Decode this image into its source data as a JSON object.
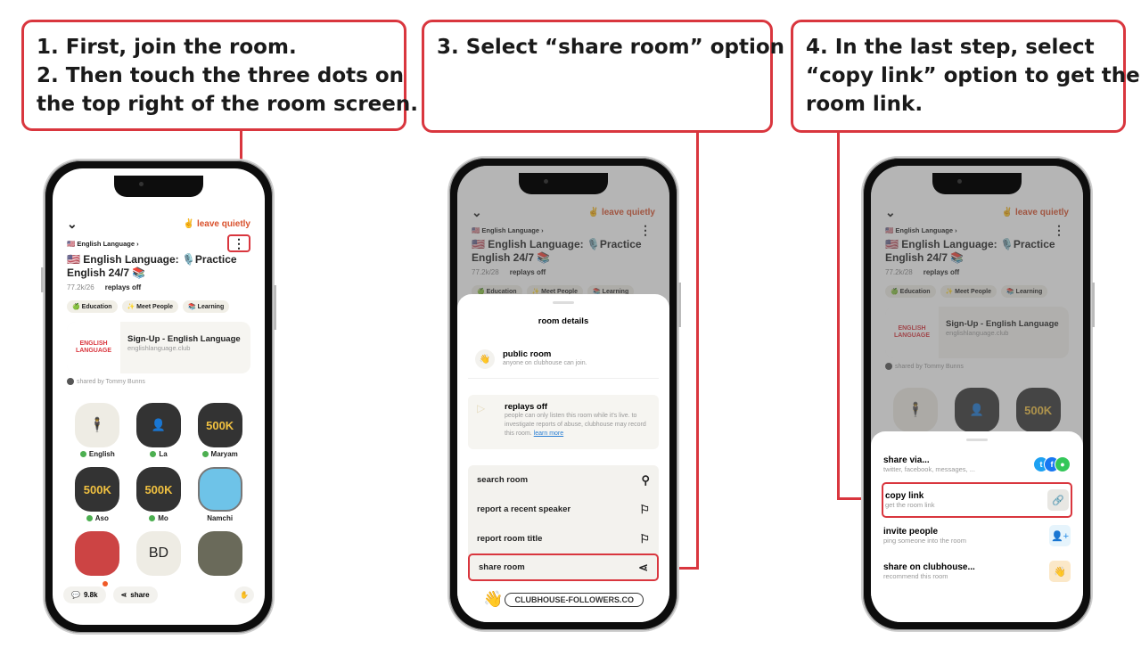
{
  "callouts": {
    "step1": [
      "1. First, join the room.",
      "2. Then touch the three dots on",
      "the top right of the room screen."
    ],
    "step3": [
      "3. Select “share room” option"
    ],
    "step4": [
      "4. In the last step, select",
      "“copy link” option to get the",
      "room link."
    ]
  },
  "room": {
    "leave_label": "✌ leave quietly",
    "club_label": "🇺🇸 English Language ›",
    "title": "🇺🇸 English Language: 🎙️Practice English 24/7 📚",
    "listeners": "77.2k/28",
    "listeners_phone1": "77.2k/26",
    "replays": "replays off",
    "tags": [
      "🍏 Education",
      "✨ Meet People",
      "📚 Learning"
    ],
    "link_card": {
      "logo_text": "ENGLISH LANGUAGE",
      "title": "Sign-Up - English Language",
      "url": "englishlanguage.club"
    },
    "shared_by": "shared by Tommy Bunns",
    "speakers": [
      {
        "name": "English",
        "online": true,
        "pic": ""
      },
      {
        "name": "La",
        "online": true,
        "pic": "👤"
      },
      {
        "name": "Maryam",
        "online": true,
        "pic": "500K"
      },
      {
        "name": "Aso",
        "online": true,
        "pic": "500K"
      },
      {
        "name": "Mo",
        "online": true,
        "pic": "500K"
      },
      {
        "name": "Namchi",
        "online": false,
        "pic": ""
      },
      {
        "name": "",
        "online": false,
        "pic": ""
      },
      {
        "name": "",
        "online": false,
        "pic": "BD"
      },
      {
        "name": "",
        "online": false,
        "pic": ""
      }
    ],
    "bottom": {
      "chat_count": "9.8k",
      "share_label": "share"
    }
  },
  "room_details": {
    "title": "room details",
    "public": {
      "heading": "public room",
      "sub": "anyone on clubhouse can join."
    },
    "replays": {
      "heading": "replays off",
      "sub": "people can only listen this room while it's live. to investigate reports of abuse, clubhouse may record this room.",
      "link": "learn more"
    },
    "actions": [
      "search room",
      "report a recent speaker",
      "report room title",
      "share room"
    ],
    "watermark": "CLUBHOUSE-FOLLOWERS.CO"
  },
  "share_sheet": {
    "items": [
      {
        "heading": "share via...",
        "sub": "twitter, facebook, messages, ..."
      },
      {
        "heading": "copy link",
        "sub": "get the room link"
      },
      {
        "heading": "invite people",
        "sub": "ping someone into the room"
      },
      {
        "heading": "share on clubhouse...",
        "sub": "recommend this room"
      }
    ]
  },
  "colors": {
    "accent_red": "#d9363e",
    "leave_orange": "#d9512c",
    "online_green": "#4caf50"
  }
}
